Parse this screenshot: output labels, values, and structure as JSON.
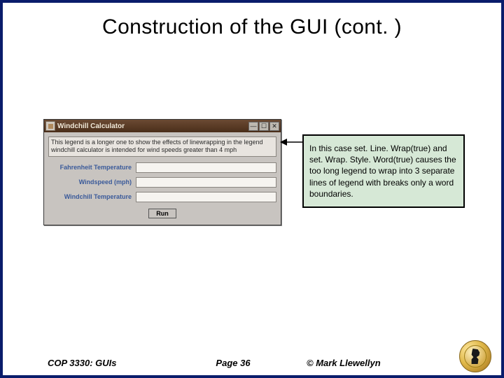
{
  "title": "Construction of the GUI (cont. )",
  "window": {
    "title": "Windchill Calculator",
    "legend": "This legend is a longer one to show the effects of linewrapping in the legend windchill calculator is intended for wind speeds greater than 4 mph",
    "fields": {
      "f1_label": "Fahrenheit Temperature",
      "f2_label": "Windspeed (mph)",
      "f3_label": "Windchill Temperature"
    },
    "run_label": "Run"
  },
  "callout": "In this case set. Line. Wrap(true) and set. Wrap. Style. Word(true) causes the too long legend to wrap into 3 separate lines of legend with breaks only a word boundaries.",
  "footer": {
    "left": "COP 3330:  GUIs",
    "mid": "Page 36",
    "right": "© Mark Llewellyn"
  }
}
